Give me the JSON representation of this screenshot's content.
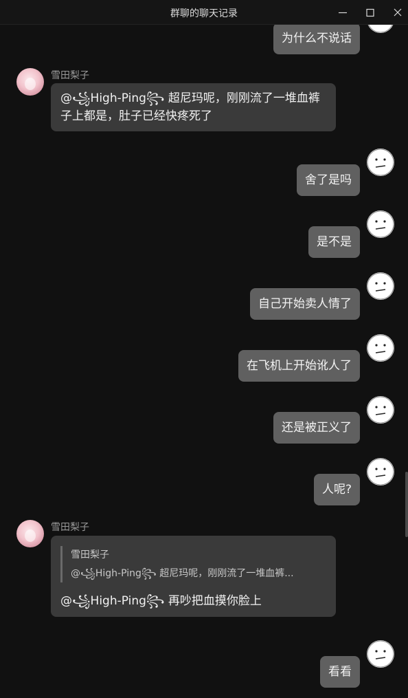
{
  "window": {
    "title": "群聊的聊天记录",
    "controls": [
      "minimize-icon",
      "maximize-icon",
      "close-icon"
    ]
  },
  "participants": {
    "other_name": "雪田梨子"
  },
  "messages": [
    {
      "sender": "self",
      "text": "为什么不说话"
    },
    {
      "sender": "other",
      "name": "雪田梨子",
      "text": "@꧁High-Ping꧂ 超尼玛呢，刚刚流了一堆血裤子上都是，肚子已经快疼死了"
    },
    {
      "sender": "self",
      "text": "舍了是吗"
    },
    {
      "sender": "self",
      "text": "是不是"
    },
    {
      "sender": "self",
      "text": "自己开始卖人情了"
    },
    {
      "sender": "self",
      "text": "在飞机上开始讹人了"
    },
    {
      "sender": "self",
      "text": "还是被正义了"
    },
    {
      "sender": "self",
      "text": "人呢?"
    },
    {
      "sender": "other",
      "name": "雪田梨子",
      "quote": {
        "name": "雪田梨子",
        "text": "@꧁High-Ping꧂ 超尼玛呢，刚刚流了一堆血裤..."
      },
      "text": "@꧁High-Ping꧂ 再吵把血摸你脸上"
    },
    {
      "sender": "self",
      "text": "看看"
    }
  ]
}
